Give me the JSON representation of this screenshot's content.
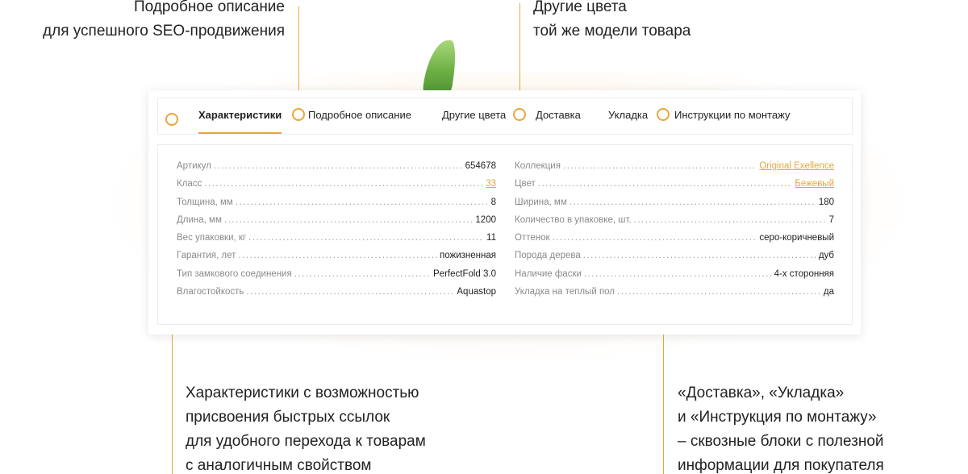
{
  "annotations": {
    "top_left": [
      "Подробное описание",
      "для успешного SEO-продвижения"
    ],
    "top_right": [
      "Другие цвета",
      "той же модели товара"
    ],
    "bottom_left": [
      "Характеристики с возможностью",
      "присвоения быстрых ссылок",
      "для удобного перехода к товарам",
      "с аналогичным свойством"
    ],
    "bottom_right": [
      "«Доставка», «Укладка»",
      "и «Инструкция по монтажу»",
      "– сквозные блоки с полезной",
      "информации для покупателя"
    ]
  },
  "tabs": [
    {
      "label": "Характеристики",
      "active": true
    },
    {
      "label": "Подробное описание",
      "active": false
    },
    {
      "label": "Другие цвета",
      "active": false
    },
    {
      "label": "Доставка",
      "active": false
    },
    {
      "label": "Укладка",
      "active": false
    },
    {
      "label": "Инструкции по монтажу",
      "active": false
    }
  ],
  "specs_left": [
    {
      "label": "Артикул",
      "value": "654678",
      "link": false
    },
    {
      "label": "Класс",
      "value": "33",
      "link": true
    },
    {
      "label": "Толщина, мм",
      "value": "8",
      "link": false
    },
    {
      "label": "Длина, мм",
      "value": "1200",
      "link": false
    },
    {
      "label": "Вес упаковки, кг",
      "value": "11",
      "link": false
    },
    {
      "label": "Гарантия, лет",
      "value": "пожизненная",
      "link": false
    },
    {
      "label": "Тип замкового соединения",
      "value": "PerfectFold 3.0",
      "link": false
    },
    {
      "label": "Влагостойкость",
      "value": "Aquastop",
      "link": false
    }
  ],
  "specs_right": [
    {
      "label": "Коллекция",
      "value": "Original Exellence",
      "link": true
    },
    {
      "label": "Цвет",
      "value": "Бежевый",
      "link": true
    },
    {
      "label": "Ширина, мм",
      "value": "180",
      "link": false
    },
    {
      "label": "Количество в упаковке, шт.",
      "value": "7",
      "link": false
    },
    {
      "label": "Оттенок",
      "value": "серо-коричневый",
      "link": false
    },
    {
      "label": "Порода дерева",
      "value": "дуб",
      "link": false
    },
    {
      "label": "Наличие фаски",
      "value": "4-х сторонняя",
      "link": false
    },
    {
      "label": "Укладка на теплый пол",
      "value": "да",
      "link": false
    }
  ],
  "colors": {
    "accent": "#e8a63c",
    "label": "#8a8a8a",
    "text": "#222222"
  }
}
